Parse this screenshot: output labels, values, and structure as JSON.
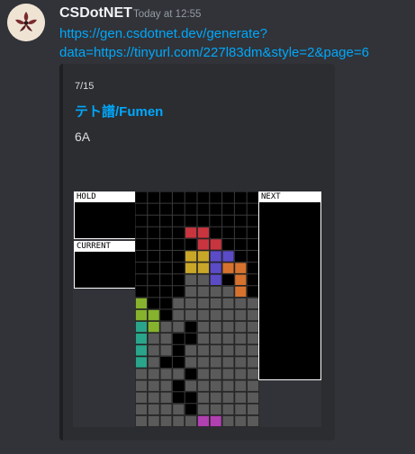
{
  "message": {
    "username": "CSDotNET",
    "timestamp": "Today at 12:55",
    "link_line1": "https://gen.csdotnet.dev/generate?",
    "link_line2": "data=https://tinyurl.com/227l83dm&style=2&page=6"
  },
  "embed": {
    "counter": "7/15",
    "title": "テト譜/Fumen",
    "description": "6A",
    "hold_label": "HOLD",
    "current_label": "CURRENT",
    "next_label": "NEXT"
  },
  "board": {
    "columns": 10,
    "rows": 20,
    "colors": {
      "Z": "#c8353f",
      "O": "#c9a627",
      "J": "#5b4bc6",
      "L": "#d6722e",
      "S": "#86b22e",
      "I": "#2aa48a",
      "T": "#b140b0",
      "G": "#5a5a5a"
    },
    "rows_data": [
      "..........",
      "..........",
      "..........",
      "....ZZ....",
      ".....ZZ...",
      "....OOJJ..",
      "....OOJLL.",
      "....GGJ.L.",
      "....GGGGL.",
      "S..GGGGGGG",
      "SS.GGGGGGG",
      "ISGG.GGGGG",
      "IGG..GGGGG",
      "IGG.GGGGGG",
      "IG..GGGGGG",
      "GGGG.GGGGG",
      "GGG.GGGGGG",
      "GGG..GGGGG",
      "GGGG.GGGGG",
      "GGGGGTTGGG"
    ]
  }
}
